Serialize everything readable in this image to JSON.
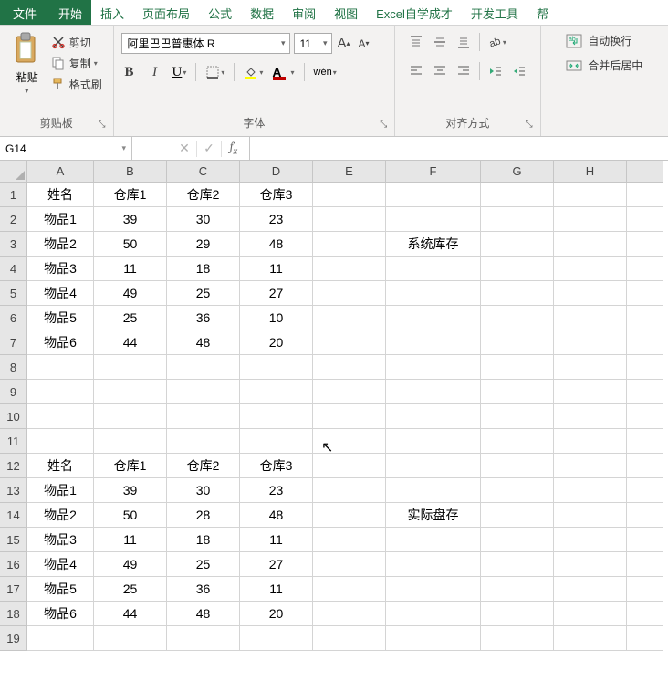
{
  "tabs": [
    "文件",
    "开始",
    "插入",
    "页面布局",
    "公式",
    "数据",
    "审阅",
    "视图",
    "Excel自学成才",
    "开发工具",
    "帮"
  ],
  "active_tab_index": 1,
  "clipboard_group": {
    "label": "剪贴板",
    "paste": "粘贴",
    "cut": "剪切",
    "copy": "复制",
    "format_painter": "格式刷"
  },
  "font_group": {
    "label": "字体",
    "font_name": "阿里巴巴普惠体 R",
    "font_size": "11",
    "bold": "B",
    "italic": "I",
    "underline": "U",
    "wen": "wén"
  },
  "align_group": {
    "label": "对齐方式",
    "wrap_text": "自动换行",
    "merge_center": "合并后居中"
  },
  "namebox_value": "G14",
  "formula_value": "",
  "columns": [
    "A",
    "B",
    "C",
    "D",
    "E",
    "F",
    "G",
    "H",
    ""
  ],
  "col_classes": [
    "cA",
    "cB",
    "cC",
    "cD",
    "cE",
    "cF",
    "cG",
    "cH",
    "cI"
  ],
  "row_count": 19,
  "sheet_data": {
    "1": {
      "A": "姓名",
      "B": "仓库1",
      "C": "仓库2",
      "D": "仓库3"
    },
    "2": {
      "A": "物品1",
      "B": "39",
      "C": "30",
      "D": "23"
    },
    "3": {
      "A": "物品2",
      "B": "50",
      "C": "29",
      "D": "48",
      "F": "系统库存"
    },
    "4": {
      "A": "物品3",
      "B": "11",
      "C": "18",
      "D": "11"
    },
    "5": {
      "A": "物品4",
      "B": "49",
      "C": "25",
      "D": "27"
    },
    "6": {
      "A": "物品5",
      "B": "25",
      "C": "36",
      "D": "10"
    },
    "7": {
      "A": "物品6",
      "B": "44",
      "C": "48",
      "D": "20"
    },
    "12": {
      "A": "姓名",
      "B": "仓库1",
      "C": "仓库2",
      "D": "仓库3"
    },
    "13": {
      "A": "物品1",
      "B": "39",
      "C": "30",
      "D": "23"
    },
    "14": {
      "A": "物品2",
      "B": "50",
      "C": "28",
      "D": "48",
      "F": "实际盘存"
    },
    "15": {
      "A": "物品3",
      "B": "11",
      "C": "18",
      "D": "11"
    },
    "16": {
      "A": "物品4",
      "B": "49",
      "C": "25",
      "D": "27"
    },
    "17": {
      "A": "物品5",
      "B": "25",
      "C": "36",
      "D": "11"
    },
    "18": {
      "A": "物品6",
      "B": "44",
      "C": "48",
      "D": "20"
    }
  }
}
